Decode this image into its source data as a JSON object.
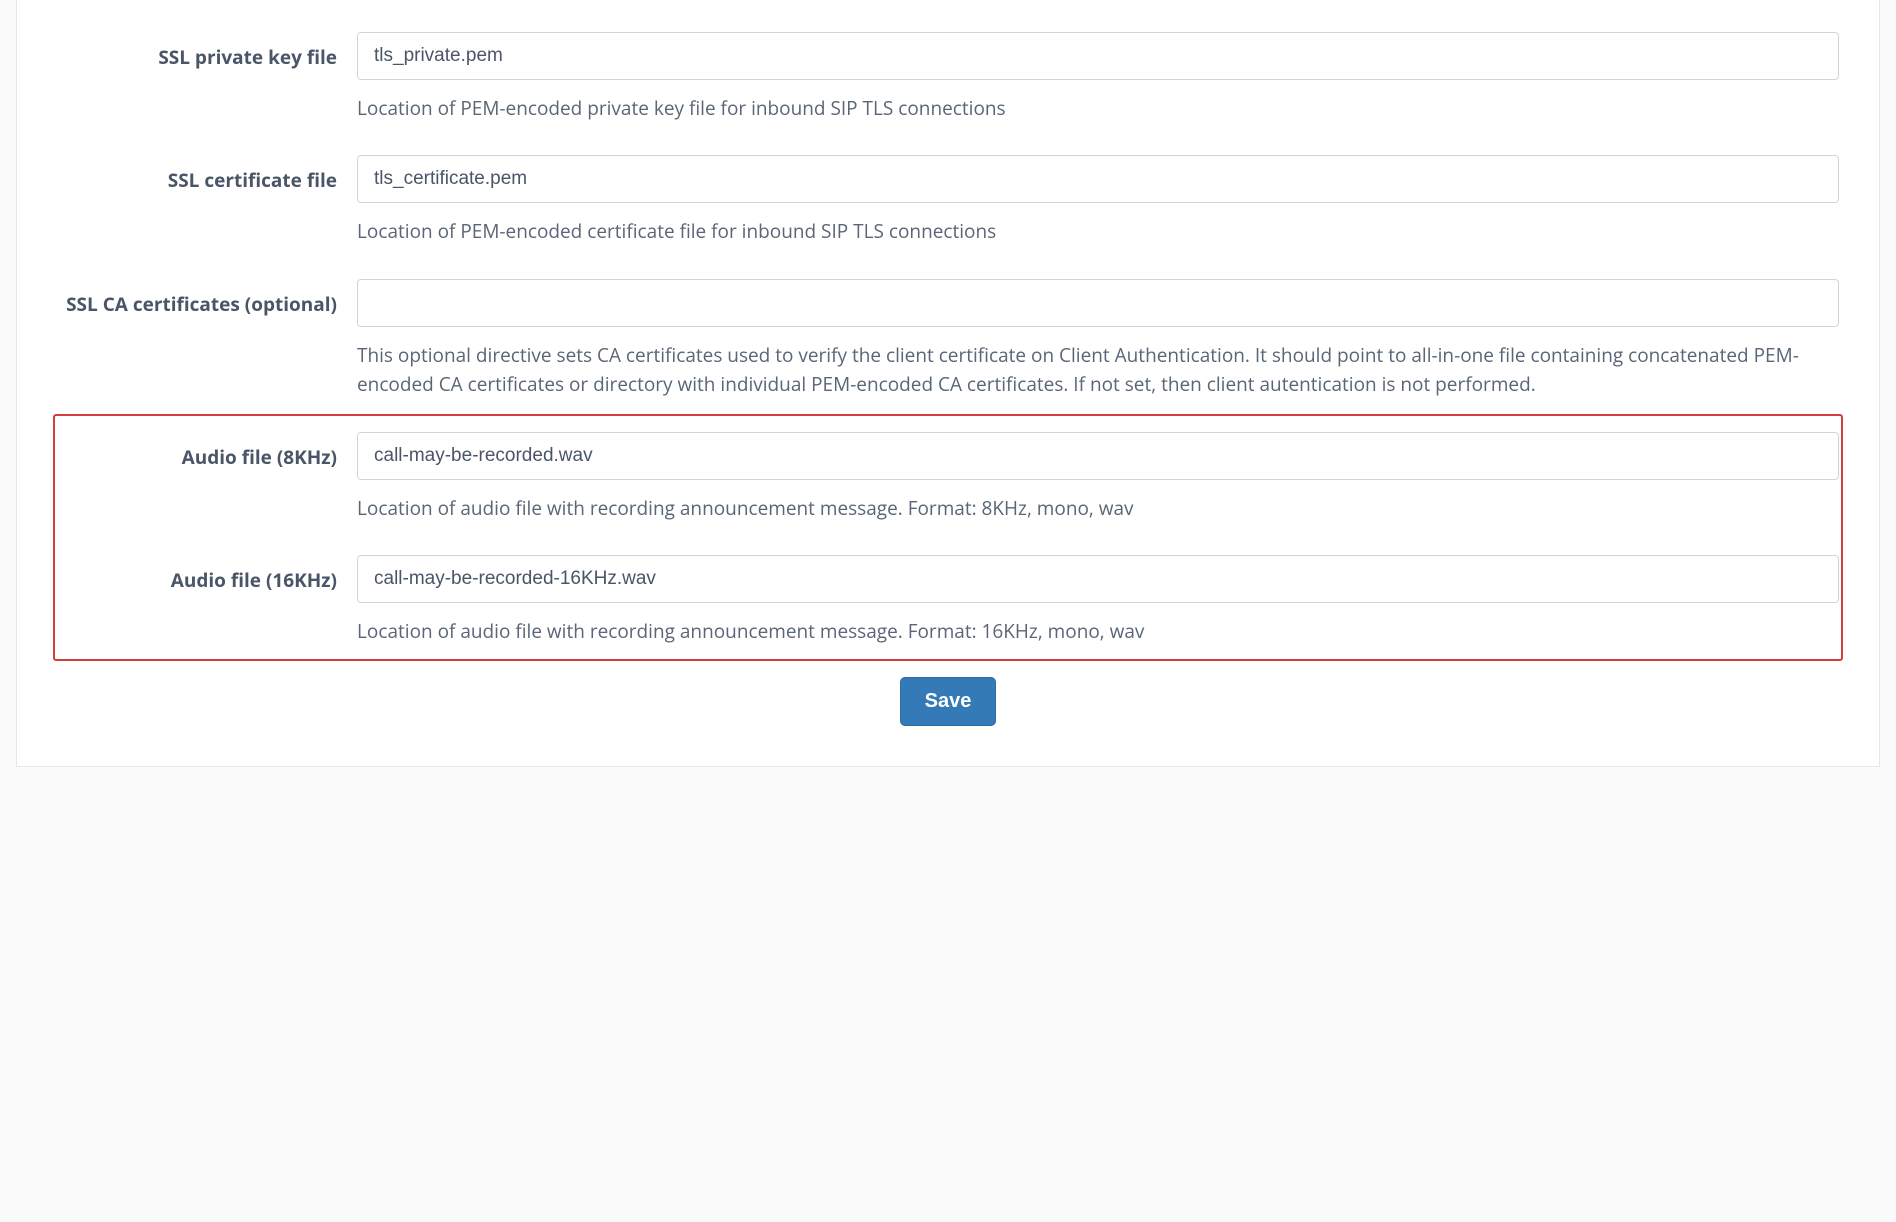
{
  "fields": {
    "ssl_private_key": {
      "label": "SSL private key file",
      "value": "tls_private.pem",
      "help": "Location of PEM-encoded private key file for inbound SIP TLS connections"
    },
    "ssl_certificate": {
      "label": "SSL certificate file",
      "value": "tls_certificate.pem",
      "help": "Location of PEM-encoded certificate file for inbound SIP TLS connections"
    },
    "ssl_ca_certificates": {
      "label": "SSL CA certificates (optional)",
      "value": "",
      "help": "This optional directive sets CA certificates used to verify the client certificate on Client Authentication. It should point to all-in-one file containing concatenated PEM-encoded CA certificates or directory with individual PEM-encoded CA certificates. If not set, then client autentication is not performed."
    },
    "audio_8khz": {
      "label": "Audio file (8KHz)",
      "value": "call-may-be-recorded.wav",
      "help": "Location of audio file with recording announcement message. Format: 8KHz, mono, wav"
    },
    "audio_16khz": {
      "label": "Audio file (16KHz)",
      "value": "call-may-be-recorded-16KHz.wav",
      "help": "Location of audio file with recording announcement message. Format: 16KHz, mono, wav"
    }
  },
  "buttons": {
    "save": "Save"
  }
}
